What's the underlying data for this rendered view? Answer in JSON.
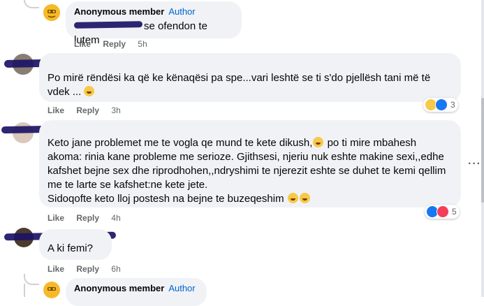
{
  "comments": [
    {
      "name": "Anonymous member",
      "badge": "Author",
      "text": "se ofendon te lutem",
      "actions": {
        "like": "Like",
        "reply": "Reply",
        "time": "5h"
      }
    },
    {
      "text": "Po mirë rëndësi ka që ke kënaqësi pa spe...vari leshtë se ti s'do pjellësh tani më të vdek ...",
      "actions": {
        "like": "Like",
        "reply": "Reply",
        "time": "3h"
      },
      "reaction_count": "3"
    },
    {
      "lines": [
        "Keto jane problemet me te vogla qe mund te kete dikush,",
        "po ti mire mbahesh",
        "akoma: rinia kane probleme me serioze. Gjithsesi, njeriu nuk eshte makine sexi,,edhe",
        "kafshet bejne sex dhe riprodhohen,,ndryshimi te njerezit eshte se duhet te kemi qellim",
        "me te larte se kafshet:ne kete jete.",
        "Sidoqofte keto lloj postesh na bejne te buzeqeshim"
      ],
      "actions": {
        "like": "Like",
        "reply": "Reply",
        "time": "4h"
      },
      "reaction_count": "5"
    },
    {
      "text": "A ki femi?",
      "actions": {
        "like": "Like",
        "reply": "Reply",
        "time": "6h"
      }
    },
    {
      "name": "Anonymous member",
      "badge": "Author"
    }
  ],
  "icons": {
    "anon_avatar": "anonymous-avatar-icon",
    "more": "more-options-icon",
    "haha": "haha-reaction-icon",
    "like": "like-reaction-icon",
    "love": "love-reaction-icon"
  },
  "colors": {
    "bubble": "#f0f2f5",
    "author_badge": "#0064d1",
    "meta": "#65676b",
    "redaction": "#1b1464"
  }
}
